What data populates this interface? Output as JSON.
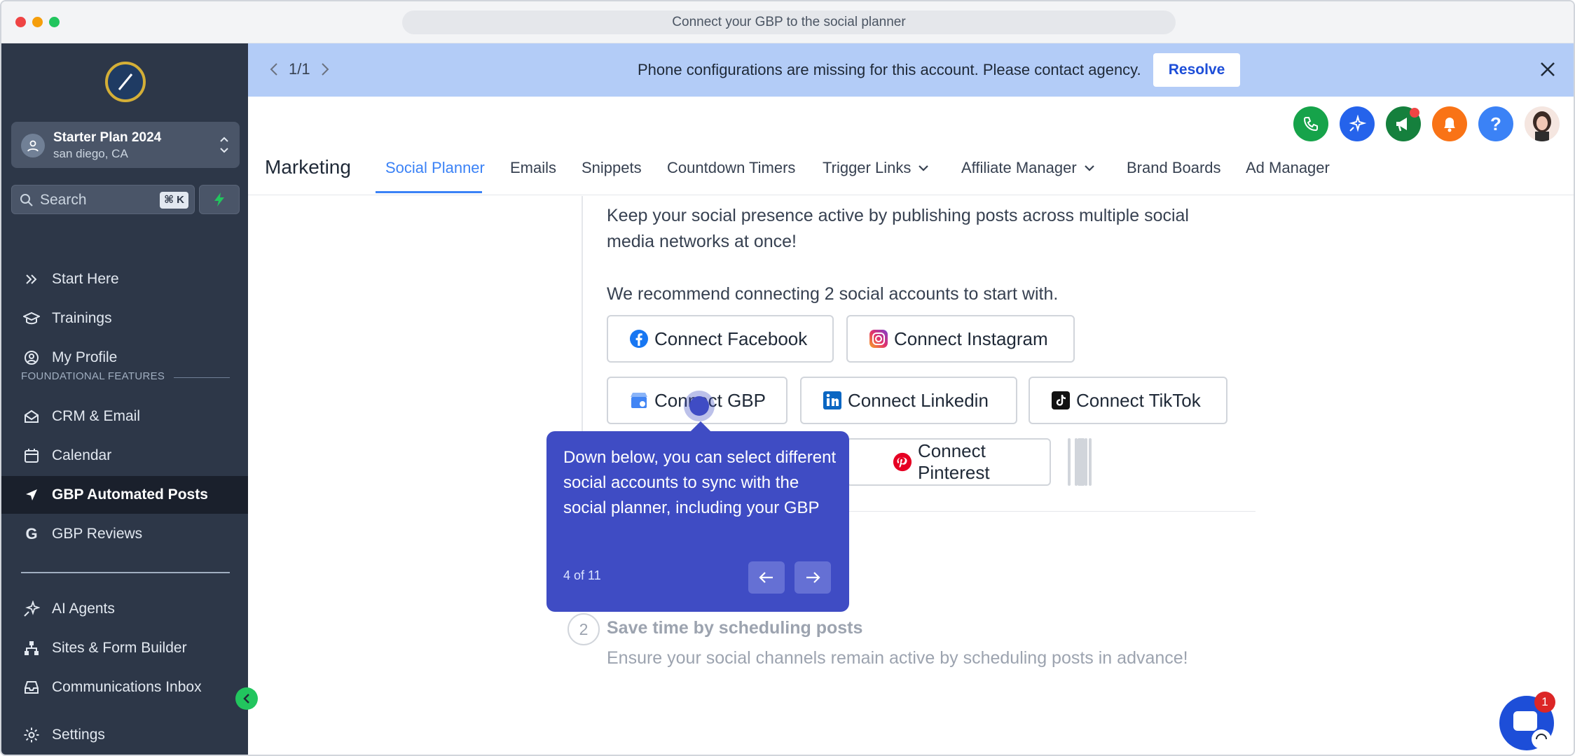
{
  "window": {
    "title": "Connect your GBP to the social planner"
  },
  "sidebar": {
    "account": {
      "name": "Starter Plan 2024",
      "location": "san diego, CA"
    },
    "search": {
      "placeholder": "Search",
      "shortcut": "⌘ K"
    },
    "items": [
      {
        "label": "Start Here",
        "icon": "double-chevron-icon"
      },
      {
        "label": "Trainings",
        "icon": "graduation-cap-icon"
      },
      {
        "label": "My Profile",
        "icon": "user-circle-icon"
      },
      {
        "label": "CRM & Email",
        "icon": "envelope-open-icon"
      },
      {
        "label": "Calendar",
        "icon": "calendar-icon"
      },
      {
        "label": "GBP Automated Posts",
        "icon": "location-arrow-icon"
      },
      {
        "label": "GBP Reviews",
        "icon": "google-g-icon"
      },
      {
        "label": "AI Agents",
        "icon": "sparkles-icon"
      },
      {
        "label": "Sites & Form Builder",
        "icon": "sitemap-icon"
      },
      {
        "label": "Communications Inbox",
        "icon": "inbox-icon"
      },
      {
        "label": "Settings",
        "icon": "gear-icon"
      }
    ],
    "section_label": "FOUNDATIONAL FEATURES"
  },
  "banner": {
    "pager": "1/1",
    "message": "Phone configurations are missing for this account. Please contact agency.",
    "resolve_label": "Resolve"
  },
  "header": {
    "title": "Marketing",
    "tabs": [
      "Social Planner",
      "Emails",
      "Snippets",
      "Countdown Timers",
      "Trigger Links",
      "Affiliate Manager",
      "Brand Boards",
      "Ad Manager"
    ]
  },
  "content": {
    "para1_line1": "Keep your social presence active by publishing posts across multiple social",
    "para1_line2": "media networks at once!",
    "para2": "We recommend connecting 2 social accounts to start with.",
    "buttons": {
      "facebook": "Connect Facebook",
      "instagram": "Connect Instagram",
      "gbp": "Connect GBP",
      "linkedin": "Connect Linkedin",
      "tiktok": "Connect TikTok",
      "pinterest": "Connect Pinterest"
    },
    "step2": {
      "number": "2",
      "title": "Save time by scheduling posts",
      "subtitle": "Ensure your social channels remain active by scheduling posts in advance!"
    }
  },
  "tooltip": {
    "text": "Down below, you can select different social accounts to sync with the social planner, including your GBP",
    "count": "4 of 11"
  },
  "chat": {
    "badge": "1"
  },
  "colors": {
    "sidebar": "#2d3748",
    "banner": "#b3ccf7",
    "accent": "#3b82f6",
    "tooltip": "#3f4cc4"
  }
}
